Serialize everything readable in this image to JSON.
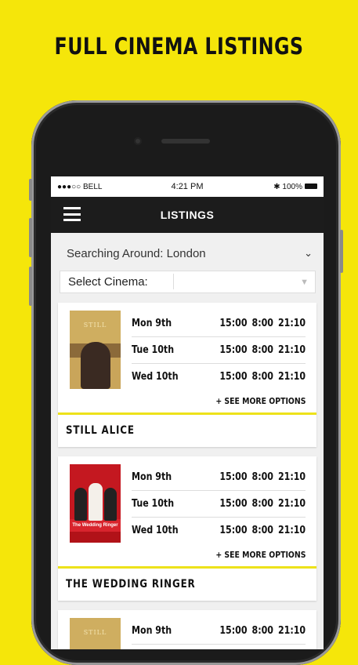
{
  "headline": "FULL CINEMA LISTINGS",
  "status_bar": {
    "carrier": "●●●○○ BELL",
    "time": "4:21 PM",
    "battery": "100%"
  },
  "nav": {
    "title": "LISTINGS"
  },
  "search": {
    "label": "Searching Around: London"
  },
  "cinema_select": {
    "label": "Select Cinema:"
  },
  "see_more_label": "+ SEE MORE OPTIONS",
  "movies": [
    {
      "title": "STILL ALICE",
      "poster_title": "STILL",
      "showtimes": [
        {
          "day": "Mon 9th",
          "times": [
            "15:00",
            "8:00",
            "21:10"
          ]
        },
        {
          "day": "Tue 10th",
          "times": [
            "15:00",
            "8:00",
            "21:10"
          ]
        },
        {
          "day": "Wed 10th",
          "times": [
            "15:00",
            "8:00",
            "21:10"
          ]
        }
      ]
    },
    {
      "title": "THE WEDDING RINGER",
      "poster_title": "The Wedding Ringer",
      "showtimes": [
        {
          "day": "Mon 9th",
          "times": [
            "15:00",
            "8:00",
            "21:10"
          ]
        },
        {
          "day": "Tue 10th",
          "times": [
            "15:00",
            "8:00",
            "21:10"
          ]
        },
        {
          "day": "Wed 10th",
          "times": [
            "15:00",
            "8:00",
            "21:10"
          ]
        }
      ]
    },
    {
      "poster_title": "STILL",
      "showtimes": [
        {
          "day": "Mon 9th",
          "times": [
            "15:00",
            "8:00",
            "21:10"
          ]
        }
      ]
    }
  ],
  "colors": {
    "background": "#f5e60a",
    "accent_line": "#ede21a",
    "navbar": "#1c1c1c"
  }
}
